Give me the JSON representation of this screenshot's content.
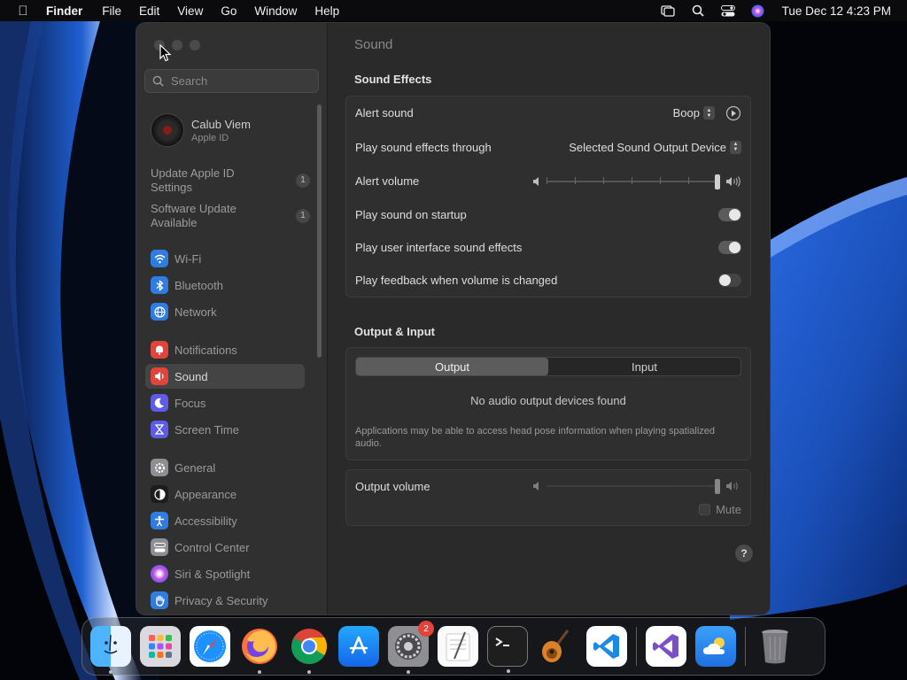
{
  "menubar": {
    "app_name": "Finder",
    "menus": [
      "File",
      "Edit",
      "View",
      "Go",
      "Window",
      "Help"
    ],
    "clock": "Tue Dec 12  4:23 PM"
  },
  "sidebar": {
    "search_placeholder": "Search",
    "user": {
      "name": "Calub Viem",
      "subtitle": "Apple ID"
    },
    "notices": [
      {
        "label": "Update Apple ID Settings",
        "count": "1"
      },
      {
        "label": "Software Update Available",
        "count": "1"
      }
    ],
    "items": [
      {
        "label": "Wi-Fi",
        "icon": "wifi-icon",
        "color": "#2f7de1"
      },
      {
        "label": "Bluetooth",
        "icon": "bluetooth-icon",
        "color": "#2f7de1"
      },
      {
        "label": "Network",
        "icon": "globe-icon",
        "color": "#2f7de1"
      },
      {
        "label": "Notifications",
        "icon": "bell-icon",
        "color": "#e0443a"
      },
      {
        "label": "Sound",
        "icon": "speaker-icon",
        "color": "#e0443a"
      },
      {
        "label": "Focus",
        "icon": "moon-icon",
        "color": "#5e5ce6"
      },
      {
        "label": "Screen Time",
        "icon": "hourglass-icon",
        "color": "#5e5ce6"
      },
      {
        "label": "General",
        "icon": "gear-icon",
        "color": "#8e8e93"
      },
      {
        "label": "Appearance",
        "icon": "appearance-icon",
        "color": "#1c1c1e"
      },
      {
        "label": "Accessibility",
        "icon": "accessibility-icon",
        "color": "#2f7de1"
      },
      {
        "label": "Control Center",
        "icon": "control-center-icon",
        "color": "#8e8e93"
      },
      {
        "label": "Siri & Spotlight",
        "icon": "siri-icon",
        "color": "#b34ad8"
      },
      {
        "label": "Privacy & Security",
        "icon": "hand-icon",
        "color": "#2f7de1"
      }
    ],
    "active": "Sound"
  },
  "content": {
    "page_title": "Sound",
    "sound_effects": {
      "title": "Sound Effects",
      "alert_sound": {
        "label": "Alert sound",
        "value": "Boop"
      },
      "play_through": {
        "label": "Play sound effects through",
        "value": "Selected Sound Output Device"
      },
      "alert_volume": {
        "label": "Alert volume",
        "level": 1.0
      },
      "startup": {
        "label": "Play sound on startup",
        "on": true
      },
      "ui_effects": {
        "label": "Play user interface sound effects",
        "on": true
      },
      "feedback": {
        "label": "Play feedback when volume is changed",
        "on": false
      }
    },
    "output_input": {
      "title": "Output & Input",
      "tabs": [
        "Output",
        "Input"
      ],
      "selected_tab": "Output",
      "empty_message": "No audio output devices found",
      "note": "Applications may be able to access head pose information when playing spatialized audio."
    },
    "output_volume": {
      "label": "Output volume",
      "level": 1.0,
      "mute_label": "Mute",
      "muted": false
    },
    "help_label": "?"
  },
  "dock": {
    "apps": [
      "Finder",
      "Launchpad",
      "Safari",
      "Firefox",
      "Chrome",
      "App Store",
      "System Settings",
      "TextEdit",
      "Terminal",
      "GarageBand",
      "Visual Studio Code",
      "Visual Studio",
      "Weather",
      "Trash"
    ],
    "settings_badge": "2"
  }
}
